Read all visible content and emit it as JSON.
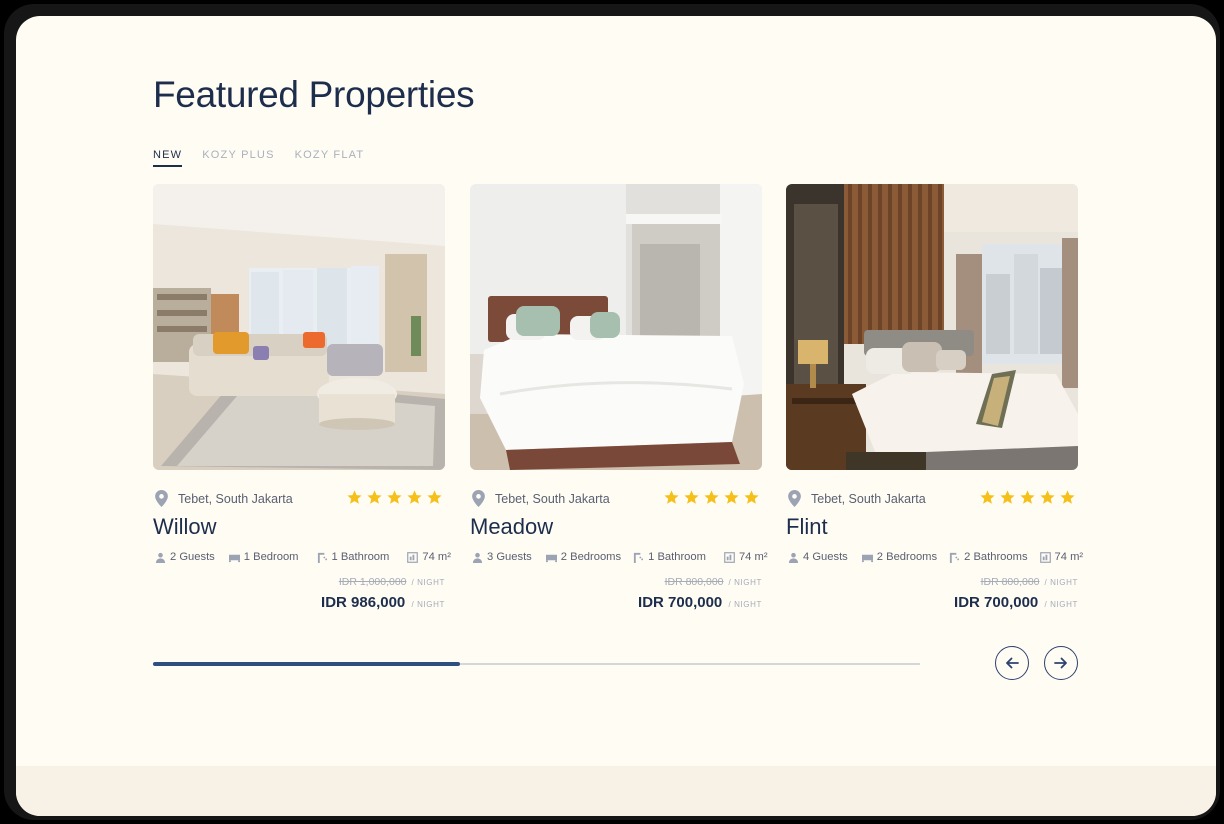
{
  "section": {
    "title": "Featured Properties"
  },
  "tabs": [
    {
      "label": "NEW",
      "active": true
    },
    {
      "label": "KOZY PLUS",
      "active": false
    },
    {
      "label": "KOZY FLAT",
      "active": false
    }
  ],
  "cards": [
    {
      "name": "Willow",
      "location": "Tebet, South Jakarta",
      "rating": 5,
      "guests": "2 Guests",
      "bedrooms": "1 Bedroom",
      "bathrooms": "1 Bathroom",
      "area": "74 m²",
      "old_price": "IDR 1,000,000",
      "price": "IDR 986,000",
      "unit": "/ NIGHT",
      "photo": "living-room-photo"
    },
    {
      "name": "Meadow",
      "location": "Tebet, South Jakarta",
      "rating": 5,
      "guests": "3 Guests",
      "bedrooms": "2 Bedrooms",
      "bathrooms": "1 Bathroom",
      "area": "74 m²",
      "old_price": "IDR 800,000",
      "price": "IDR 700,000",
      "unit": "/ NIGHT",
      "photo": "white-bedroom-photo"
    },
    {
      "name": "Flint",
      "location": "Tebet, South Jakarta",
      "rating": 5,
      "guests": "4 Guests",
      "bedrooms": "2 Bedrooms",
      "bathrooms": "2 Bathrooms",
      "area": "74 m²",
      "old_price": "IDR 800,000",
      "price": "IDR 700,000",
      "unit": "/ NIGHT",
      "photo": "wood-panel-bedroom-photo"
    }
  ],
  "carousel": {
    "progress": 0.4
  },
  "icons": {
    "prev": "arrow-left-icon",
    "next": "arrow-right-icon",
    "location": "location-pin-icon",
    "rating": "star-icon"
  },
  "colors": {
    "primary": "#1d2e4d",
    "accent": "#2e4f80",
    "star": "#f5c01a",
    "background": "#fffcf4"
  }
}
